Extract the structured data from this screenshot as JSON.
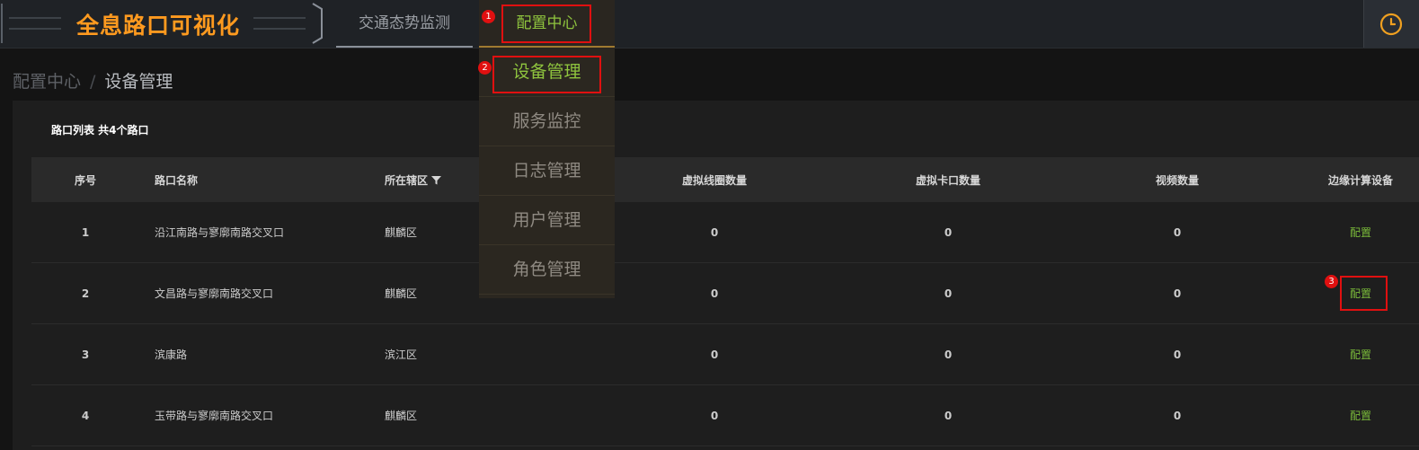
{
  "header": {
    "app_title": "全息路口可视化",
    "tabs": [
      {
        "label": "交通态势监测",
        "active": false
      },
      {
        "label": "配置中心",
        "active": true
      }
    ],
    "clock_icon": "clock-icon"
  },
  "breadcrumb": {
    "parent": "配置中心",
    "separator": "/",
    "current": "设备管理"
  },
  "dropdown": {
    "items": [
      {
        "label": "设备管理",
        "active": true
      },
      {
        "label": "服务监控",
        "active": false
      },
      {
        "label": "日志管理",
        "active": false
      },
      {
        "label": "用户管理",
        "active": false
      },
      {
        "label": "角色管理",
        "active": false
      }
    ]
  },
  "table": {
    "title": "路口列表 共4个路口",
    "columns": [
      "序号",
      "路口名称",
      "所在辖区",
      "虚拟线圈数量",
      "虚拟卡口数量",
      "视频数量",
      "边缘计算设备"
    ],
    "rows": [
      {
        "index": "1",
        "name": "沿江南路与寥廓南路交叉口",
        "district": "麒麟区",
        "loops": "0",
        "checkpoints": "0",
        "videos": "0",
        "action": "配置"
      },
      {
        "index": "2",
        "name": "文昌路与寥廓南路交叉口",
        "district": "麒麟区",
        "loops": "0",
        "checkpoints": "0",
        "videos": "0",
        "action": "配置"
      },
      {
        "index": "3",
        "name": "滨康路",
        "district": "滨江区",
        "loops": "0",
        "checkpoints": "0",
        "videos": "0",
        "action": "配置"
      },
      {
        "index": "4",
        "name": "玉带路与寥廓南路交叉口",
        "district": "麒麟区",
        "loops": "0",
        "checkpoints": "0",
        "videos": "0",
        "action": "配置"
      }
    ]
  },
  "annotations": [
    "1",
    "2",
    "3"
  ],
  "colors": {
    "accent_green": "#8fc43e",
    "title_orange": "#ff9a1f",
    "annotation_red": "#e01010"
  }
}
